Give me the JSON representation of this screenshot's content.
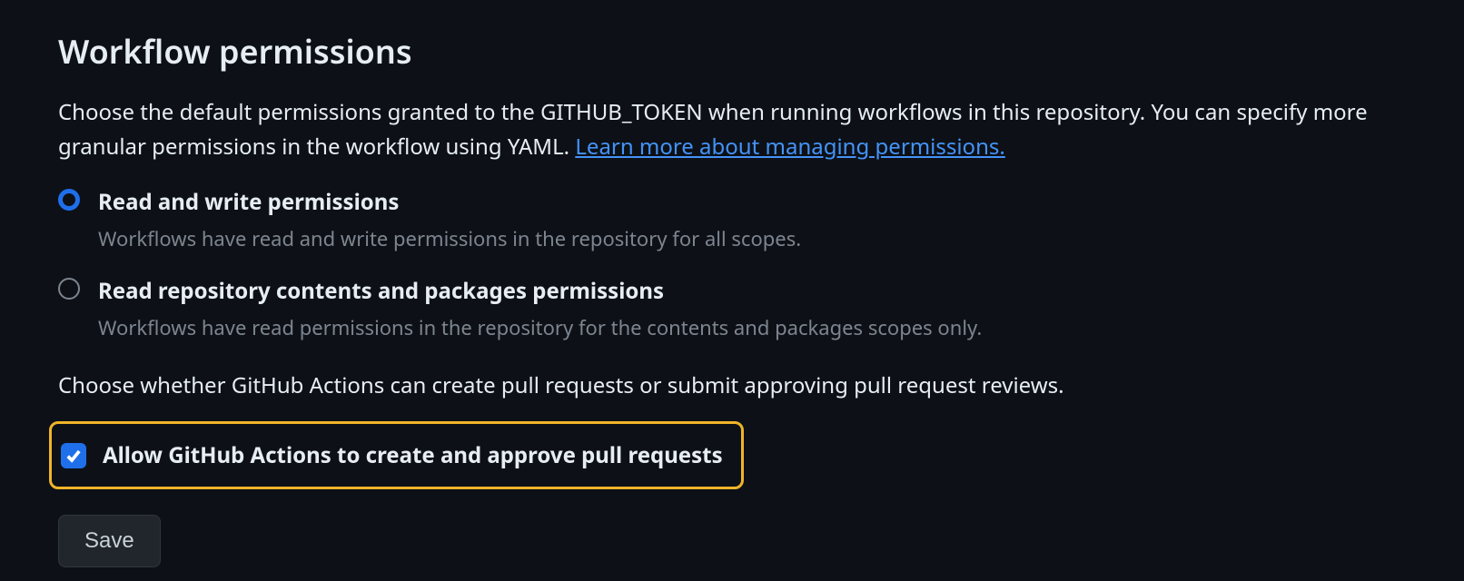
{
  "section": {
    "title": "Workflow permissions",
    "description_part1": "Choose the default permissions granted to the GITHUB_TOKEN when running workflows in this repository. You can specify more granular permissions in the workflow using YAML. ",
    "link_text": "Learn more about managing permissions."
  },
  "radio_options": [
    {
      "label": "Read and write permissions",
      "description": "Workflows have read and write permissions in the repository for all scopes.",
      "selected": true
    },
    {
      "label": "Read repository contents and packages permissions",
      "description": "Workflows have read permissions in the repository for the contents and packages scopes only.",
      "selected": false
    }
  ],
  "checkbox_section": {
    "subtext": "Choose whether GitHub Actions can create pull requests or submit approving pull request reviews.",
    "checkbox_label": "Allow GitHub Actions to create and approve pull requests",
    "checked": true
  },
  "save_button": {
    "label": "Save"
  }
}
